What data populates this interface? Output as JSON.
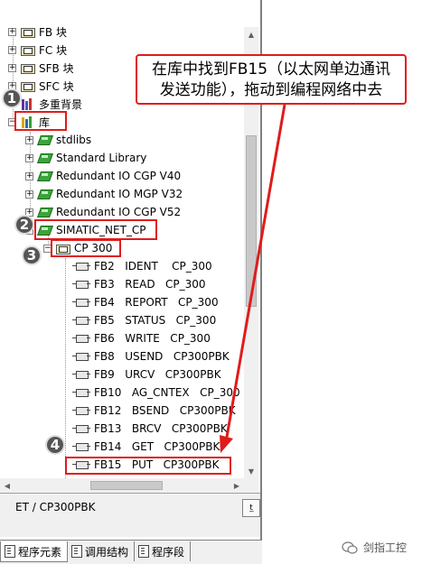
{
  "tree": {
    "top_items": [
      {
        "label": "FB 块"
      },
      {
        "label": "FC 块"
      },
      {
        "label": "SFB 块"
      },
      {
        "label": "SFC 块"
      }
    ],
    "multi_label": "多重背景",
    "lib_root_label": "库",
    "libraries": [
      {
        "label": "stdlibs"
      },
      {
        "label": "Standard Library"
      },
      {
        "label": "Redundant IO CGP V40"
      },
      {
        "label": "Redundant IO MGP V32"
      },
      {
        "label": "Redundant IO CGP V52"
      }
    ],
    "simatic_label": "SIMATIC_NET_CP",
    "cp300_label": "CP 300",
    "blocks": [
      {
        "label": "FB2   IDENT    CP_300"
      },
      {
        "label": "FB3   READ   CP_300"
      },
      {
        "label": "FB4   REPORT   CP_300"
      },
      {
        "label": "FB5   STATUS   CP_300"
      },
      {
        "label": "FB6   WRITE   CP_300"
      },
      {
        "label": "FB8   USEND   CP300PBK"
      },
      {
        "label": "FB9   URCV   CP300PBK"
      },
      {
        "label": "FB10   AG_CNTEX   CP_300"
      },
      {
        "label": "FB12   BSEND   CP300PBK"
      },
      {
        "label": "FB13   BRCV   CP300PBK"
      },
      {
        "label": "FB14   GET   CP300PBK"
      },
      {
        "label": "FB15   PUT   CP300PBK"
      }
    ]
  },
  "status": {
    "text": "ET / CP300PBK",
    "button": "t̲"
  },
  "tabs": [
    {
      "label": "程序元素"
    },
    {
      "label": "调用结构"
    },
    {
      "label": "程序段"
    }
  ],
  "callout": {
    "line1": "在库中找到FB15（以太网单边通讯",
    "line2": "发送功能），拖动到编程网络中去"
  },
  "badges": [
    "1",
    "2",
    "3",
    "4"
  ],
  "watermark": "剑指工控",
  "colors": {
    "annotation_red": "#e01c1c",
    "lib_green": "#3aa43a"
  }
}
